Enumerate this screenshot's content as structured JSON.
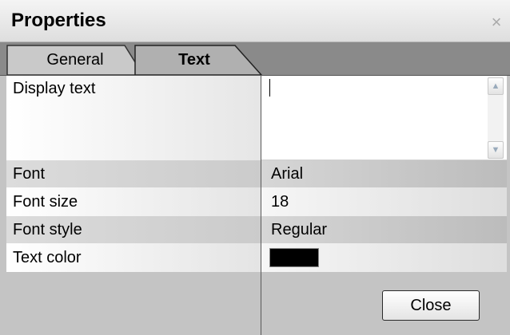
{
  "window": {
    "title": "Properties",
    "close_glyph": "×"
  },
  "tabs": [
    {
      "label": "General",
      "active": false
    },
    {
      "label": "Text",
      "active": true
    }
  ],
  "properties": {
    "display_text": {
      "label": "Display text",
      "value": ""
    },
    "font": {
      "label": "Font",
      "value": "Arial"
    },
    "font_size": {
      "label": "Font size",
      "value": "18"
    },
    "font_style": {
      "label": "Font style",
      "value": "Regular"
    },
    "text_color": {
      "label": "Text color",
      "value": "#000000"
    }
  },
  "buttons": {
    "close_label": "Close"
  },
  "icons": {
    "close": "close-icon",
    "scroll_up": "chevron-up-icon",
    "scroll_down": "chevron-down-icon"
  }
}
